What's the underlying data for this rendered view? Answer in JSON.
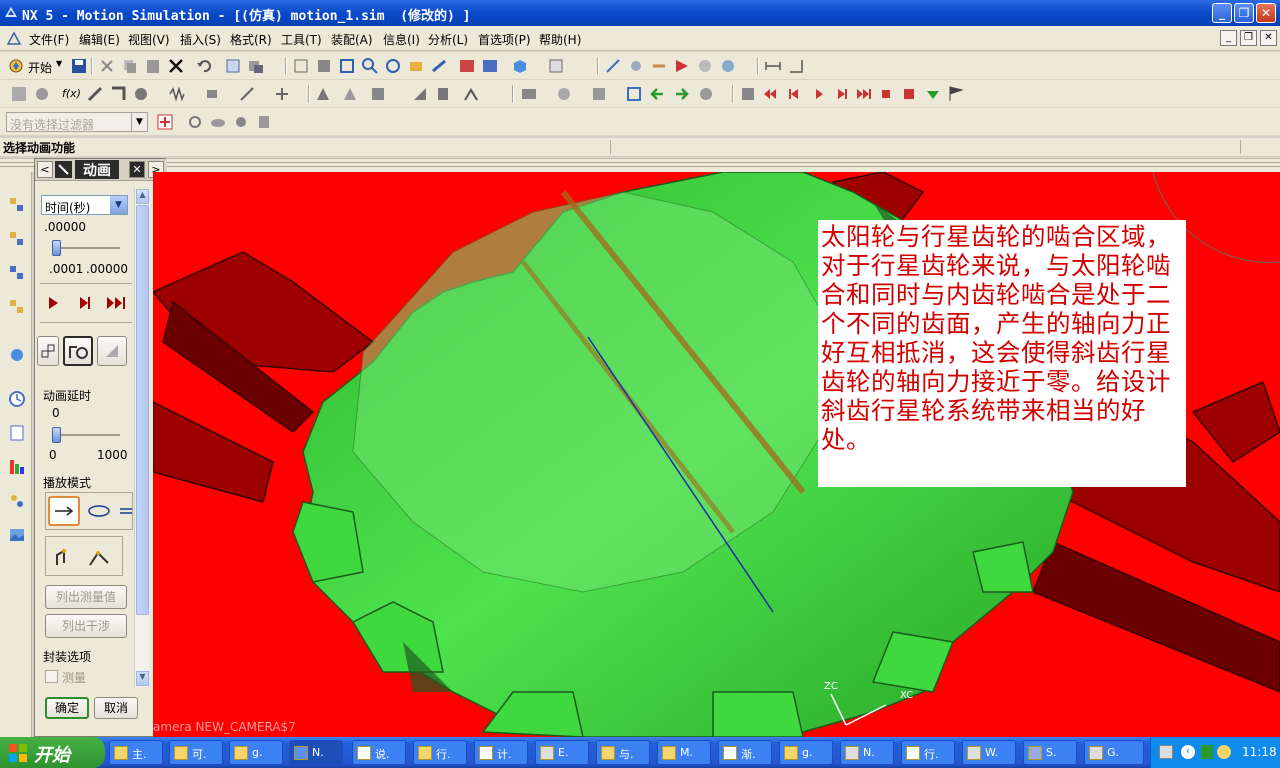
{
  "window": {
    "title": "NX 5 - Motion Simulation - [(仿真) motion_1.sim  (修改的) ]",
    "minimize": "_",
    "maximize": "❐",
    "close": "✕"
  },
  "menu": {
    "items": [
      "文件(F)",
      "编辑(E)",
      "视图(V)",
      "插入(S)",
      "格式(R)",
      "工具(T)",
      "装配(A)",
      "信息(I)",
      "分析(L)",
      "首选项(P)",
      "帮助(H)"
    ]
  },
  "toolbar": {
    "start_label": "开始",
    "filter_placeholder": "没有选择过滤器"
  },
  "status": {
    "prompt": "选择动画功能"
  },
  "anim_panel": {
    "title": "动画",
    "time_unit": "时间(秒)",
    "time_value": ".00000",
    "time_min": ".0001",
    "time_max": ".00000",
    "delay_label": "动画延时",
    "delay_value": "0",
    "delay_min": "0",
    "delay_max": "1000",
    "play_mode_label": "播放模式",
    "list_measure_button": "列出测量值",
    "list_interference_button": "列出干涉",
    "package_options_label": "封装选项",
    "measure_checkbox_label": "测量",
    "ok_button": "确定",
    "cancel_button": "取消"
  },
  "viewport": {
    "background_color": "#ff0000",
    "gear_color": "#3ed83e",
    "annotation_color": "#d40000",
    "annotation": "太阳轮与行星齿轮的啮合区域，对于行星齿轮来说，与太阳轮啮合和同时与内齿轮啮合是处于二个不同的齿面，产生的轴向力正好互相抵消，这会使得斜齿行星齿轮的轴向力接近于零。给设计斜齿行星轮系统带来相当的好处。",
    "camera_label": "amera NEW_CAMERA$7",
    "axis_zc": "ZC",
    "axis_xc": "XC"
  },
  "taskbar": {
    "start_label": "开始",
    "tasks": [
      "主.",
      "可.",
      "g.",
      "N.",
      "说.",
      "行.",
      "计.",
      "E.",
      "与.",
      "M.",
      "渐.",
      "g.",
      "N.",
      "行.",
      "W.",
      "S.",
      "G."
    ],
    "clock": "11:18"
  }
}
